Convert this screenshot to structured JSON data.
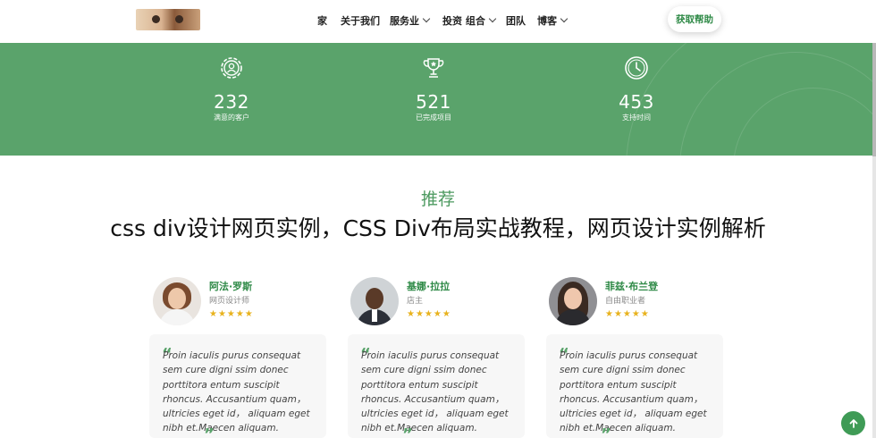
{
  "nav": {
    "items": [
      {
        "label": "家",
        "has_dropdown": false
      },
      {
        "label": "关于我们",
        "has_dropdown": false
      },
      {
        "label": "服务业",
        "has_dropdown": true
      },
      {
        "label": "投资 组合",
        "has_dropdown": true
      },
      {
        "label": "团队",
        "has_dropdown": false
      },
      {
        "label": "博客",
        "has_dropdown": true
      }
    ],
    "cta_label": "获取帮助"
  },
  "stats": [
    {
      "icon": "gear-user-icon",
      "value": "232",
      "label": "满意的客户"
    },
    {
      "icon": "trophy-icon",
      "value": "521",
      "label": "已完成项目"
    },
    {
      "icon": "clock-icon",
      "value": "453",
      "label": "支持时间"
    }
  ],
  "section": {
    "title": "推荐",
    "overlay_text": "css div设计网页实例，CSS Div布局实战教程，网页设计实例解析"
  },
  "testimonials": [
    {
      "name": "阿法·罗斯",
      "role": "网页设计师",
      "rating": 5,
      "stars": "★★★★★",
      "quote": "Proin iaculis purus consequat sem cure digni ssim donec porttitora entum suscipit rhoncus. Accusantium quam， ultricies eget id， aliquam eget nibh et.Maecen aliquam."
    },
    {
      "name": "基娜·拉拉",
      "role": "店主",
      "rating": 5,
      "stars": "★★★★★",
      "quote": "Proin iaculis purus consequat sem cure digni ssim donec porttitora entum suscipit rhoncus. Accusantium quam， ultricies eget id， aliquam eget nibh et.Maecen aliquam."
    },
    {
      "name": "菲兹·布兰登",
      "role": "自由职业者",
      "rating": 5,
      "stars": "★★★★★",
      "quote": "Proin iaculis purus consequat sem cure digni ssim donec porttitora entum suscipit rhoncus. Accusantium quam， ultricies eget id， aliquam eget nibh et.Maecen aliquam."
    }
  ],
  "scroll_top_icon": "arrow-up-icon",
  "colors": {
    "accent": "#5aa36b",
    "accent_dark": "#2f8a47",
    "star": "#e8b21d"
  }
}
